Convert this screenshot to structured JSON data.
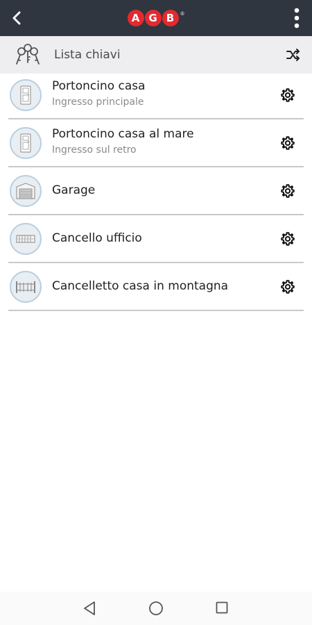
{
  "header": {
    "logo_letters": [
      "A",
      "G",
      "B"
    ],
    "logo_registered": "®",
    "back_icon": "chevron-left-icon",
    "menu_icon": "more-vertical-icon",
    "background": "#2f3640",
    "logo_color": "#e32a2f"
  },
  "listbar": {
    "title": "Lista chiavi",
    "left_icon": "keys-icon",
    "right_icon": "shuffle-icon"
  },
  "keys": [
    {
      "title": "Portoncino casa",
      "subtitle": "Ingresso principale",
      "icon": "door-icon"
    },
    {
      "title": "Portoncino casa al mare",
      "subtitle": "Ingresso sul retro",
      "icon": "door-icon"
    },
    {
      "title": "Garage",
      "subtitle": "",
      "icon": "garage-door-icon"
    },
    {
      "title": "Cancello ufficio",
      "subtitle": "",
      "icon": "sliding-gate-icon"
    },
    {
      "title": "Cancelletto casa in montagna",
      "subtitle": "",
      "icon": "gate-icon"
    }
  ],
  "row_action_icon": "gear-icon",
  "navbar": {
    "back_icon": "nav-back-icon",
    "home_icon": "nav-home-icon",
    "recents_icon": "nav-recents-icon"
  }
}
